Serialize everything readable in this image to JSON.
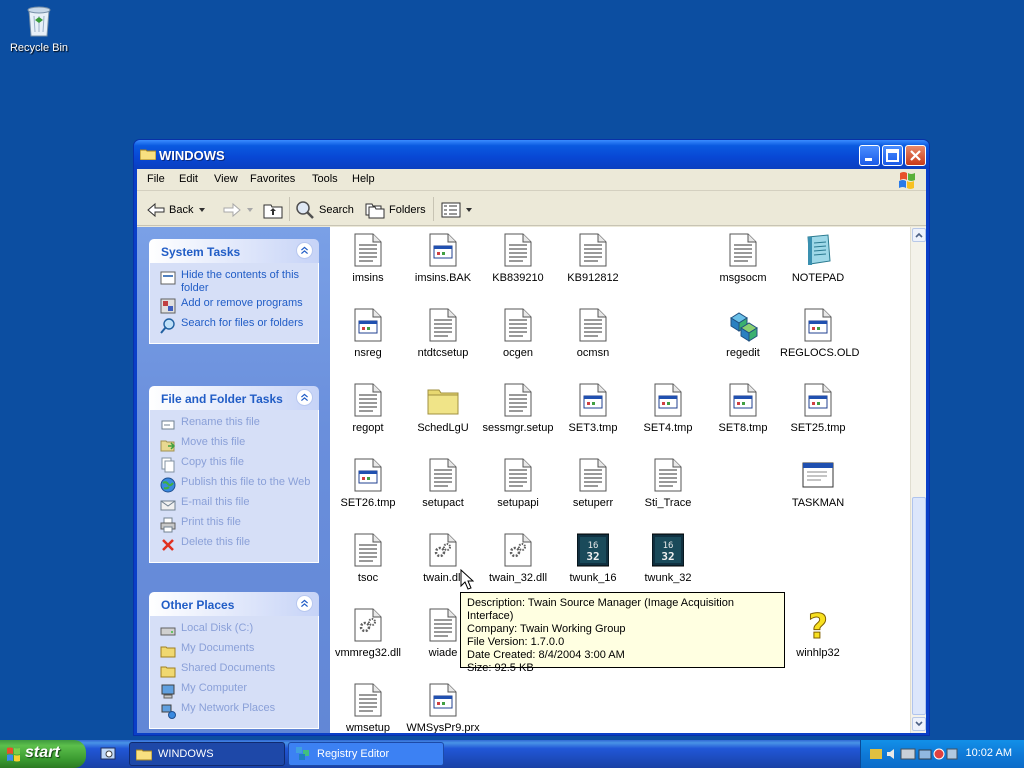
{
  "desktop": {
    "recycle_bin_label": "Recycle Bin"
  },
  "window": {
    "title": "WINDOWS",
    "menu": [
      "File",
      "Edit",
      "View",
      "Favorites",
      "Tools",
      "Help"
    ],
    "toolbar": {
      "back": "Back",
      "search": "Search",
      "folders": "Folders"
    }
  },
  "left_pane": {
    "system_tasks": {
      "title": "System Tasks",
      "items": [
        "Hide the contents of this folder",
        "Add or remove programs",
        "Search for files or folders"
      ]
    },
    "file_folder_tasks": {
      "title": "File and Folder Tasks",
      "items": [
        "Rename this file",
        "Move this file",
        "Copy this file",
        "Publish this file to the Web",
        "E-mail this file",
        "Print this file",
        "Delete this file"
      ]
    },
    "other_places": {
      "title": "Other Places",
      "items": [
        "Local Disk (C:)",
        "My Documents",
        "Shared Documents",
        "My Computer",
        "My Network Places"
      ]
    }
  },
  "files": [
    {
      "name": "imsins",
      "icon": "text-doc-icon"
    },
    {
      "name": "imsins.BAK",
      "icon": "app-doc-icon"
    },
    {
      "name": "KB839210",
      "icon": "text-doc-icon"
    },
    {
      "name": "KB912812",
      "icon": "text-doc-icon"
    },
    {
      "name": "msgsocm",
      "icon": "text-doc-icon"
    },
    {
      "name": "NOTEPAD",
      "icon": "notepad-icon"
    },
    {
      "name": "nsreg",
      "icon": "app-doc-icon"
    },
    {
      "name": "ntdtcsetup",
      "icon": "text-doc-icon"
    },
    {
      "name": "ocgen",
      "icon": "text-doc-icon"
    },
    {
      "name": "ocmsn",
      "icon": "text-doc-icon"
    },
    {
      "name": "regedit",
      "icon": "regedit-icon"
    },
    {
      "name": "REGLOCS.OLD",
      "icon": "app-doc-icon"
    },
    {
      "name": "regopt",
      "icon": "text-doc-icon"
    },
    {
      "name": "SchedLgU",
      "icon": "folder-icon"
    },
    {
      "name": "sessmgr.setup",
      "icon": "text-doc-icon"
    },
    {
      "name": "SET3.tmp",
      "icon": "app-doc-icon"
    },
    {
      "name": "SET4.tmp",
      "icon": "app-doc-icon"
    },
    {
      "name": "SET8.tmp",
      "icon": "app-doc-icon"
    },
    {
      "name": "SET25.tmp",
      "icon": "app-doc-icon"
    },
    {
      "name": "SET26.tmp",
      "icon": "app-doc-icon"
    },
    {
      "name": "setupact",
      "icon": "text-doc-icon"
    },
    {
      "name": "setupapi",
      "icon": "text-doc-icon"
    },
    {
      "name": "setuperr",
      "icon": "text-doc-icon"
    },
    {
      "name": "Sti_Trace",
      "icon": "text-doc-icon"
    },
    {
      "name": "TASKMAN",
      "icon": "window-app-icon"
    },
    {
      "name": "tsoc",
      "icon": "text-doc-icon"
    },
    {
      "name": "twain.dll",
      "icon": "dll-icon"
    },
    {
      "name": "twain_32.dll",
      "icon": "dll-icon"
    },
    {
      "name": "twunk_16",
      "icon": "twunk-icon"
    },
    {
      "name": "twunk_32",
      "icon": "twunk-icon"
    },
    {
      "name": "vmmreg32.dll",
      "icon": "dll-icon"
    },
    {
      "name": "wiade",
      "icon": "text-doc-icon"
    },
    {
      "name": "winhlp32",
      "icon": "help-icon"
    },
    {
      "name": "wmsetup",
      "icon": "text-doc-icon"
    },
    {
      "name": "WMSysPr9.prx",
      "icon": "app-doc-icon"
    }
  ],
  "tooltip": {
    "lines": [
      "Description: Twain Source Manager (Image Acquisition Interface)",
      "Company: Twain Working Group",
      "File Version: 1.7.0.0",
      "Date Created: 8/4/2004 3:00 AM",
      "Size: 92.5 KB"
    ]
  },
  "taskbar": {
    "start_label": "start",
    "items": [
      "WINDOWS",
      "Registry Editor"
    ],
    "clock": "10:02 AM"
  }
}
